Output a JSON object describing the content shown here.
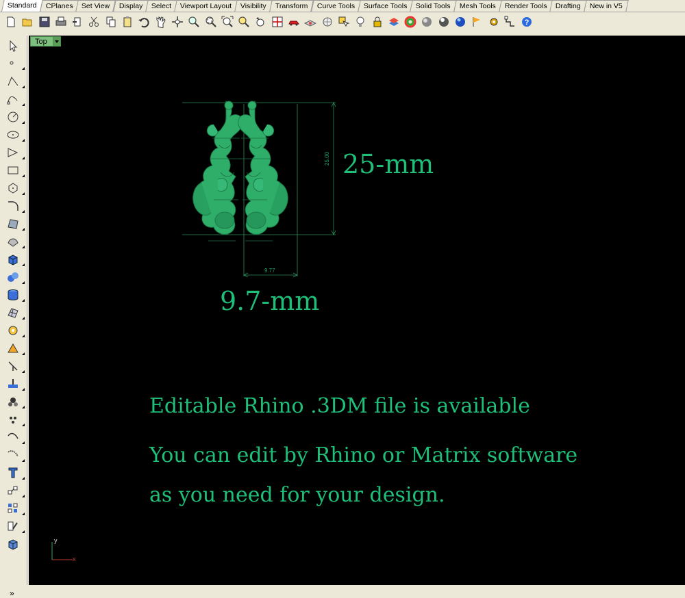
{
  "tabs": [
    "Standard",
    "CPlanes",
    "Set View",
    "Display",
    "Select",
    "Viewport Layout",
    "Visibility",
    "Transform",
    "Curve Tools",
    "Surface Tools",
    "Solid Tools",
    "Mesh Tools",
    "Render Tools",
    "Drafting",
    "New in V5"
  ],
  "toolbar_icons": [
    "new-icon",
    "open-icon",
    "save-icon",
    "print-icon",
    "import-icon",
    "cut-icon",
    "copy-icon",
    "paste-icon",
    "undo-icon",
    "pan-icon",
    "rotate-view-icon",
    "zoom-dynamic-icon",
    "zoom-window-icon",
    "zoom-extents-icon",
    "zoom-selected-icon",
    "undo-view-icon",
    "four-viewports-icon",
    "car-icon",
    "named-cplane-icon",
    "cplane-icon",
    "select-icon",
    "light-bulb-icon",
    "lock-icon",
    "layer-icon",
    "color-icon",
    "shade-icon",
    "render-icon",
    "sphere-icon",
    "flag-icon",
    "options-icon",
    "osnap-icon",
    "help-icon"
  ],
  "left_icons": [
    "select-arrow-icon",
    "point-icon",
    "polyline-icon",
    "curve-icon",
    "circle-icon",
    "ellipse-icon",
    "arc-icon",
    "rectangle-icon",
    "polygon-icon",
    "fillet-icon",
    "surface-icon",
    "loft-icon",
    "box-icon",
    "sphere-solid-icon",
    "cylinder-icon",
    "mesh-icon",
    "transform-icon",
    "explode-icon",
    "split-icon",
    "boolean-icon",
    "point-cloud-icon",
    "curve-tools-icon",
    "dimension-icon",
    "text-icon",
    "group-icon",
    "block-icon",
    "analyze-icon",
    "render-mesh-icon"
  ],
  "left_more": "»",
  "viewport": {
    "label": "Top",
    "dim_vertical": "25.00",
    "dim_horizontal": "9.77",
    "height_note": "25-mm",
    "width_note": "9.7-mm",
    "line1": "Editable Rhino .3DM file is available",
    "line2": "You can edit by Rhino or Matrix software",
    "line3": "as you need for your design.",
    "axis_x": "x",
    "axis_y": "y"
  },
  "colors": {
    "model": "#2fae6a",
    "text": "#1fbf7a",
    "background": "#000000"
  }
}
